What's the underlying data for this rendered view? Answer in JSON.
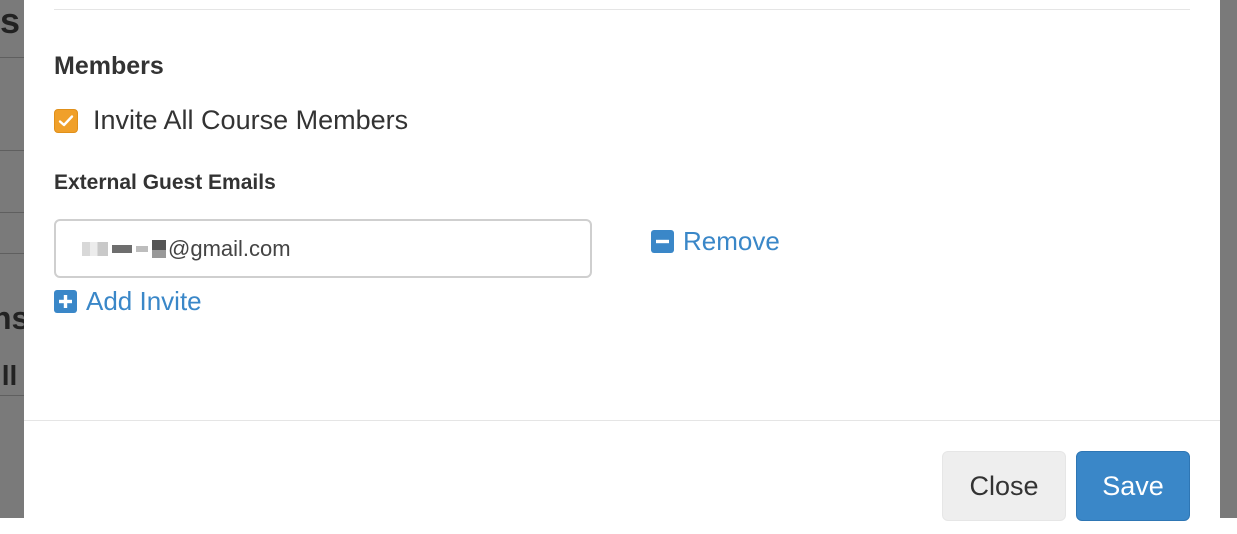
{
  "background": {
    "fragments": [
      "s",
      "ns",
      "ill"
    ]
  },
  "members": {
    "title": "Members",
    "invite_all_label": "Invite All Course Members",
    "invite_all_checked": true
  },
  "guests": {
    "label": "External Guest Emails",
    "email_value": "@gmail.com",
    "remove_label": "Remove",
    "add_label": "Add Invite"
  },
  "footer": {
    "close_label": "Close",
    "save_label": "Save"
  },
  "colors": {
    "accent": "#3a87c8",
    "checkbox": "#f0a02a"
  },
  "icons": {
    "checkbox": "check-icon",
    "remove": "minus-square-icon",
    "add": "plus-square-icon"
  }
}
